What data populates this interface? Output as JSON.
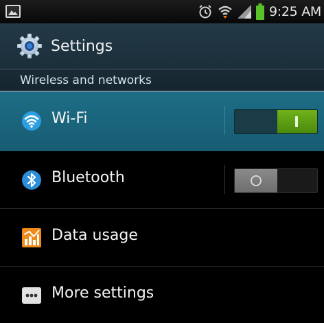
{
  "status_bar": {
    "time": "9:25 AM",
    "icons": [
      "gallery-icon",
      "alarm-icon",
      "wifi-signal-icon",
      "cell-signal-icon",
      "battery-icon"
    ]
  },
  "action_bar": {
    "title": "Settings",
    "icon": "gear-icon"
  },
  "section": {
    "title": "Wireless and networks"
  },
  "items": [
    {
      "label": "Wi-Fi",
      "icon": "wifi-icon",
      "toggle": "on"
    },
    {
      "label": "Bluetooth",
      "icon": "bluetooth-icon",
      "toggle": "off"
    },
    {
      "label": "Data usage",
      "icon": "data-usage-icon"
    },
    {
      "label": "More settings",
      "icon": "more-icon"
    }
  ],
  "colors": {
    "highlight": "#1d6d86",
    "toggle_on": "#6fb21a",
    "action_bar": "#233a47"
  }
}
